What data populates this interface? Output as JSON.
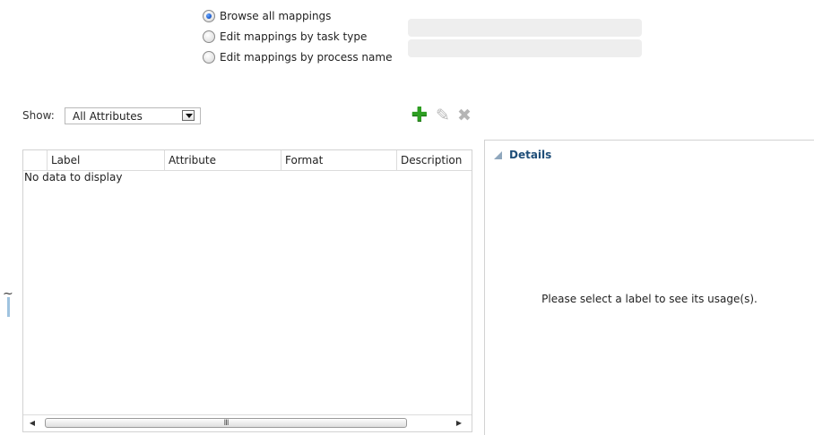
{
  "mode_options": [
    {
      "label": "Browse all mappings",
      "selected": true
    },
    {
      "label": "Edit mappings by task type",
      "selected": false
    },
    {
      "label": "Edit mappings by process name",
      "selected": false
    }
  ],
  "filter": {
    "label": "Show:",
    "value": "All Attributes"
  },
  "toolbar": {
    "add_icon": "plus-icon",
    "edit_icon": "pencil-icon",
    "delete_icon": "x-icon"
  },
  "table": {
    "columns": [
      "Label",
      "Attribute",
      "Format",
      "Description"
    ],
    "rows": [],
    "empty_message": "No data to display",
    "scroll_grip": "III"
  },
  "details": {
    "title": "Details",
    "message": "Please select a label to see its usage(s)."
  },
  "colors": {
    "accent": "#1f4e79",
    "add": "#2e9e22",
    "splitter": "#9fc3df"
  }
}
